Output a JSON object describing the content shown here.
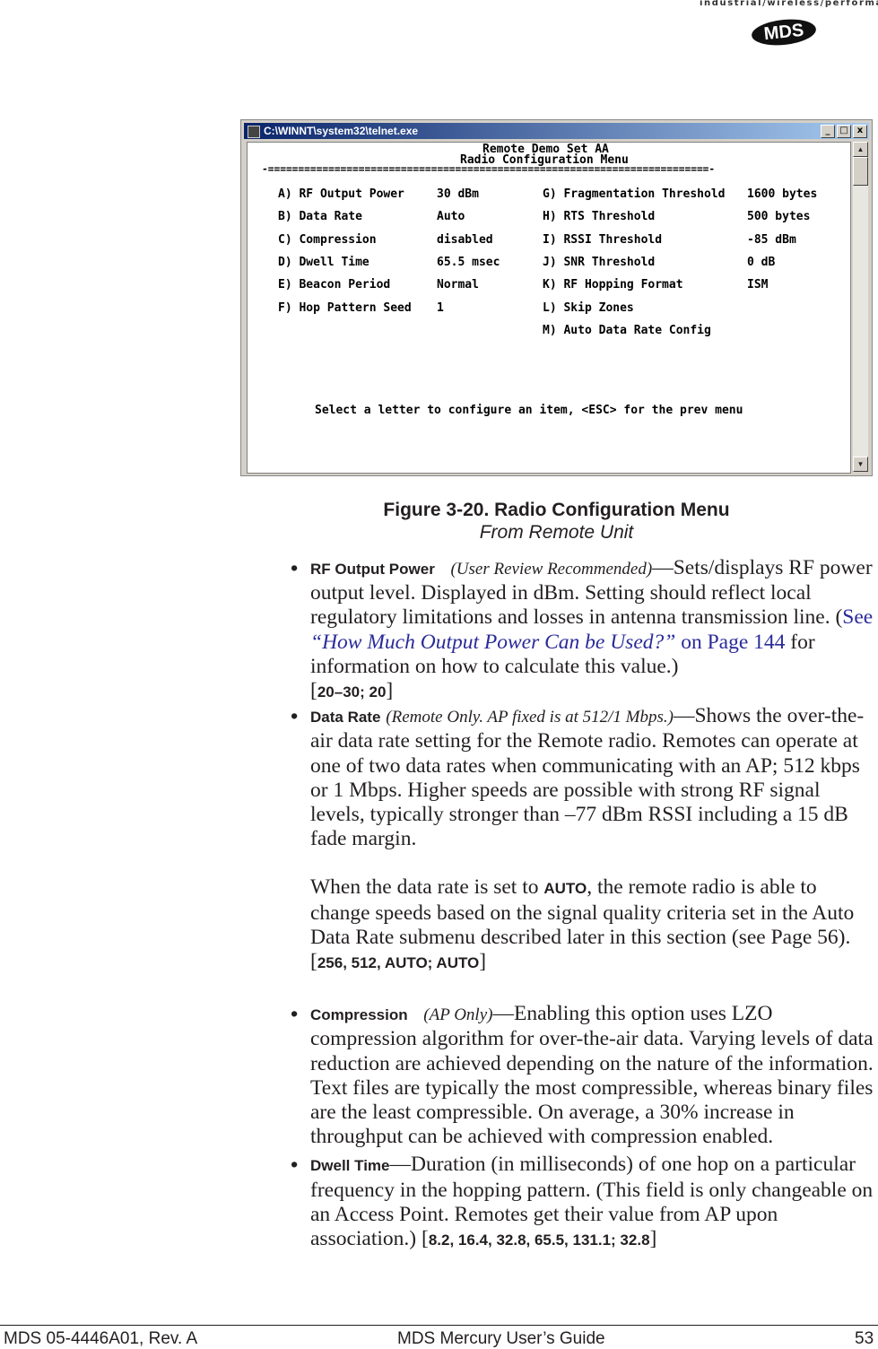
{
  "header": {
    "tagline": "industrial/wireless/performance",
    "logo": "MDS"
  },
  "window": {
    "title": "C:\\WINNT\\system32\\telnet.exe",
    "minimize": "_",
    "maximize": "□",
    "close": "x",
    "screen": {
      "line1": "Remote Demo Set AA",
      "line2": "Radio Configuration Menu",
      "divider": "-=========================================================================-",
      "left": [
        {
          "label": "A) RF Output Power",
          "value": "30 dBm"
        },
        {
          "label": "B) Data Rate",
          "value": "Auto"
        },
        {
          "label": "C) Compression",
          "value": "disabled"
        },
        {
          "label": "D) Dwell Time",
          "value": "65.5 msec"
        },
        {
          "label": "E) Beacon Period",
          "value": "Normal"
        },
        {
          "label": "F) Hop Pattern Seed",
          "value": "1"
        }
      ],
      "right": [
        {
          "label": "G) Fragmentation Threshold",
          "value": "1600 bytes"
        },
        {
          "label": "H) RTS Threshold",
          "value": "500 bytes"
        },
        {
          "label": "I) RSSI Threshold",
          "value": "-85 dBm"
        },
        {
          "label": "J) SNR Threshold",
          "value": "0 dB"
        },
        {
          "label": "K) RF Hopping Format",
          "value": "ISM"
        },
        {
          "label": "L) Skip Zones",
          "value": ""
        },
        {
          "label": "M) Auto Data Rate Config",
          "value": ""
        }
      ],
      "prompt": "Select a letter to configure an item, <ESC> for the prev menu"
    }
  },
  "caption": {
    "title": "Figure 3-20. Radio Configuration Menu",
    "subtitle": "From Remote Unit"
  },
  "items": [
    {
      "kw": "RF Output Power",
      "note": "(User Review Recommended)",
      "text1": "—Sets/displays RF power output level. Displayed in dBm. Setting should reflect local regulatory limitations and losses in antenna transmission line. (",
      "link_see": "See ",
      "link_title": "“How Much Output Power Can be Used?”",
      "link_page": " on Page 144",
      "text2": " for information on how to calculate this value.)",
      "vals": "20–30; 20"
    },
    {
      "kw": "Data Rate",
      "note": "(Remote Only. AP fixed is at 512/1 Mbps.)",
      "text1": "—Shows the over-the-air data rate setting for the Remote radio. Remotes can operate at one of two data rates when communicating with an AP; 512 kbps or 1 Mbps. Higher speeds are possible with strong RF signal levels, typically stronger than –77 dBm RSSI including a 15 dB fade margin.",
      "p2a": "When the data rate is set to ",
      "p2kw": "AUTO",
      "p2b": ", the remote radio is able to change speeds based on the signal quality criteria set in the Auto Data Rate submenu described later in this section (see Page 56).",
      "vals": "256, 512, AUTO; AUTO"
    },
    {
      "kw": "Compression",
      "note": "(AP Only)",
      "text1": "—Enabling this option uses LZO compression algorithm for over-the-air data. Varying levels of data reduction are achieved depending on the nature of the information. Text files are typically the most compressible, whereas binary files are the least compressible. On average, a 30% increase in throughput can be achieved with compression enabled."
    },
    {
      "kw": "Dwell Time",
      "text1": "—Duration (in milliseconds) of one hop on a particular frequency in the hopping pattern. (This field is only changeable on an Access Point. Remotes get their value from AP upon association.) ",
      "vals": "8.2, 16.4, 32.8, 65.5, 131.1; 32.8"
    }
  ],
  "footer": {
    "left": "MDS 05-4446A01, Rev. A",
    "center": "MDS Mercury User’s Guide",
    "page": "53"
  }
}
